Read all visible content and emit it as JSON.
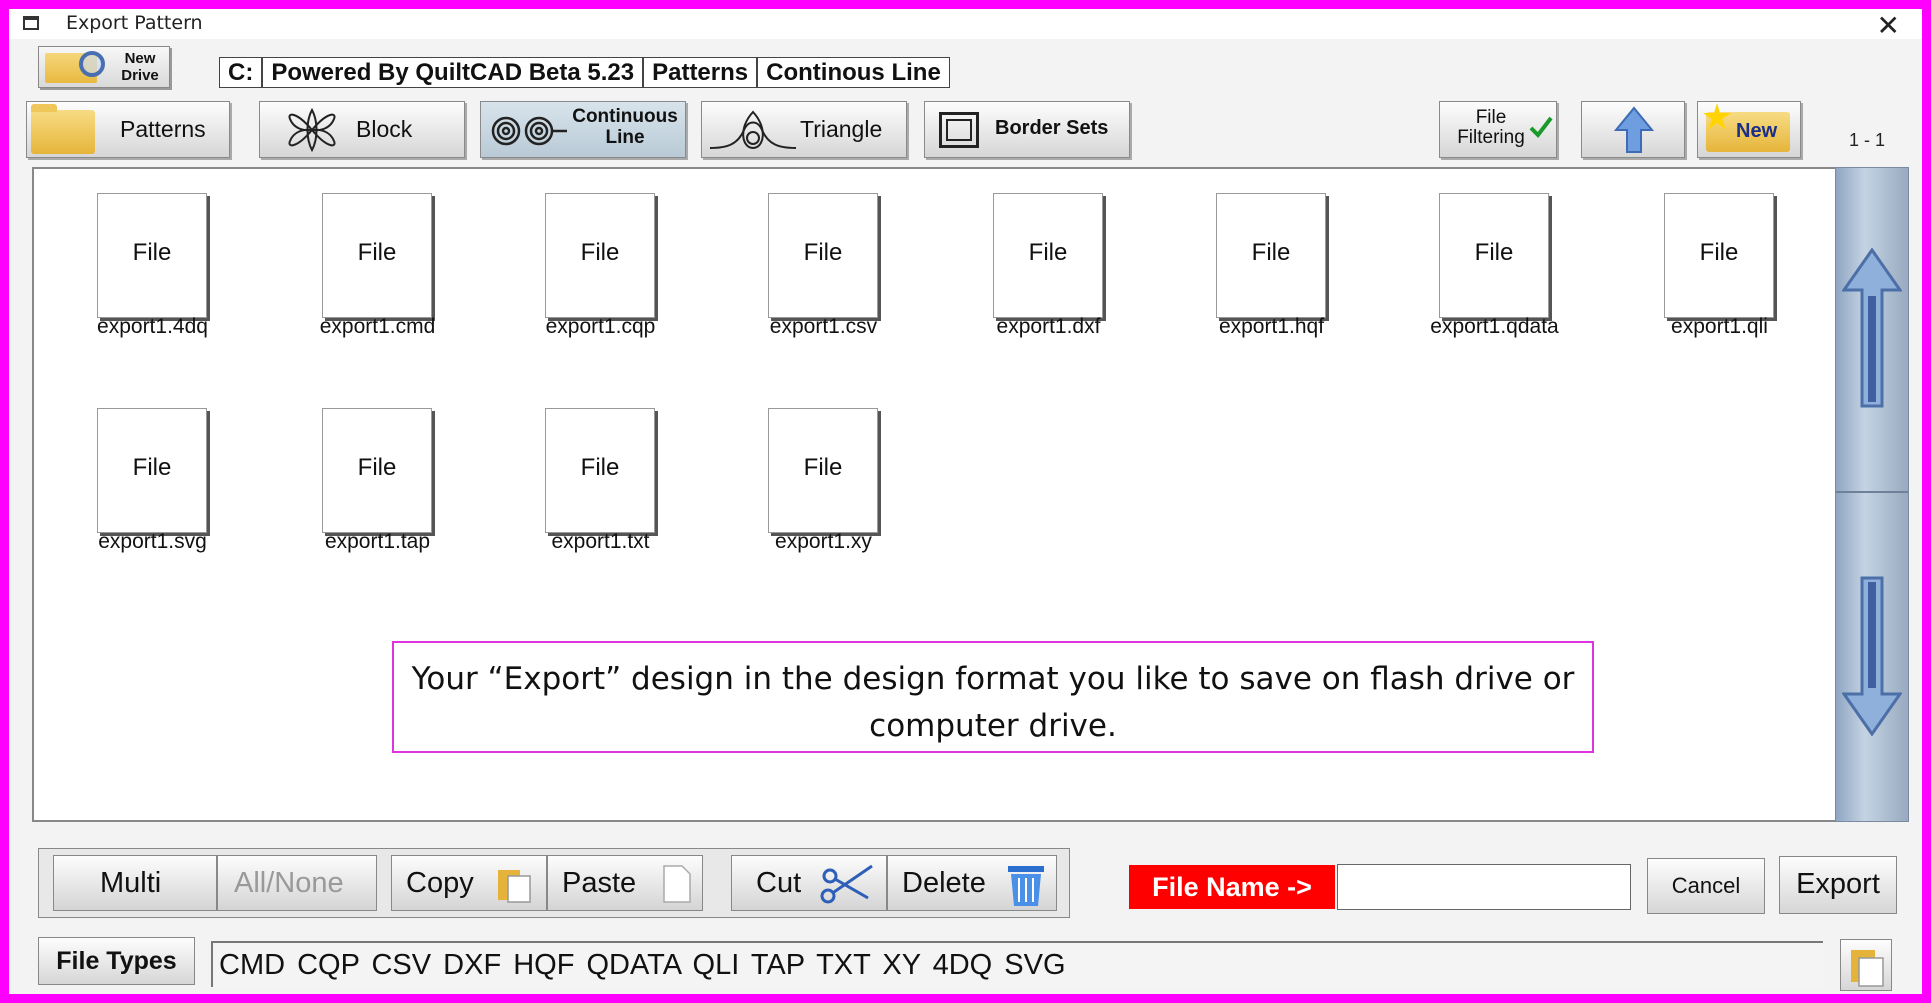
{
  "window": {
    "title": "Export Pattern",
    "close_glyph": "✕"
  },
  "new_drive": {
    "label_line1": "New",
    "label_line2": "Drive"
  },
  "path": [
    "C:",
    "Powered By QuiltCAD Beta 5.23",
    "Patterns",
    "Continous Line"
  ],
  "toolbar": {
    "patterns": "Patterns",
    "block": "Block",
    "continuous_line1": "Continuous",
    "continuous_line2": "Line",
    "triangle": "Triangle",
    "border_sets": "Border Sets",
    "file_filtering_line1": "File",
    "file_filtering_line2": "Filtering",
    "new": "New",
    "active_tab": "Continuous Line"
  },
  "range": "1 - 1",
  "files": [
    {
      "icon_label": "File",
      "name": "export1.4dq"
    },
    {
      "icon_label": "File",
      "name": "export1.cmd"
    },
    {
      "icon_label": "File",
      "name": "export1.cqp"
    },
    {
      "icon_label": "File",
      "name": "export1.csv"
    },
    {
      "icon_label": "File",
      "name": "export1.dxf"
    },
    {
      "icon_label": "File",
      "name": "export1.hqf"
    },
    {
      "icon_label": "File",
      "name": "export1.qdata"
    },
    {
      "icon_label": "File",
      "name": "export1.qli"
    },
    {
      "icon_label": "File",
      "name": "export1.svg"
    },
    {
      "icon_label": "File",
      "name": "export1.tap"
    },
    {
      "icon_label": "File",
      "name": "export1.txt"
    },
    {
      "icon_label": "File",
      "name": "export1.xy"
    }
  ],
  "note": "Your “Export” design in the design format you like to save on flash drive or computer drive.",
  "edit": {
    "multi": "Multi",
    "all_none": "All/None",
    "copy": "Copy",
    "paste": "Paste",
    "cut": "Cut",
    "delete": "Delete"
  },
  "file_name": {
    "label": "File Name ->",
    "value": ""
  },
  "actions": {
    "cancel": "Cancel",
    "export": "Export"
  },
  "file_types": {
    "label": "File Types",
    "list": "CMD  CQP  CSV  DXF  HQF  QDATA  QLI  TAP  TXT  XY  4DQ  SVG"
  },
  "colors": {
    "frame": "#ff00ff",
    "file_name_bg": "#ff0000",
    "note_border": "#e033e0",
    "scroll": "#b4c4d8"
  }
}
